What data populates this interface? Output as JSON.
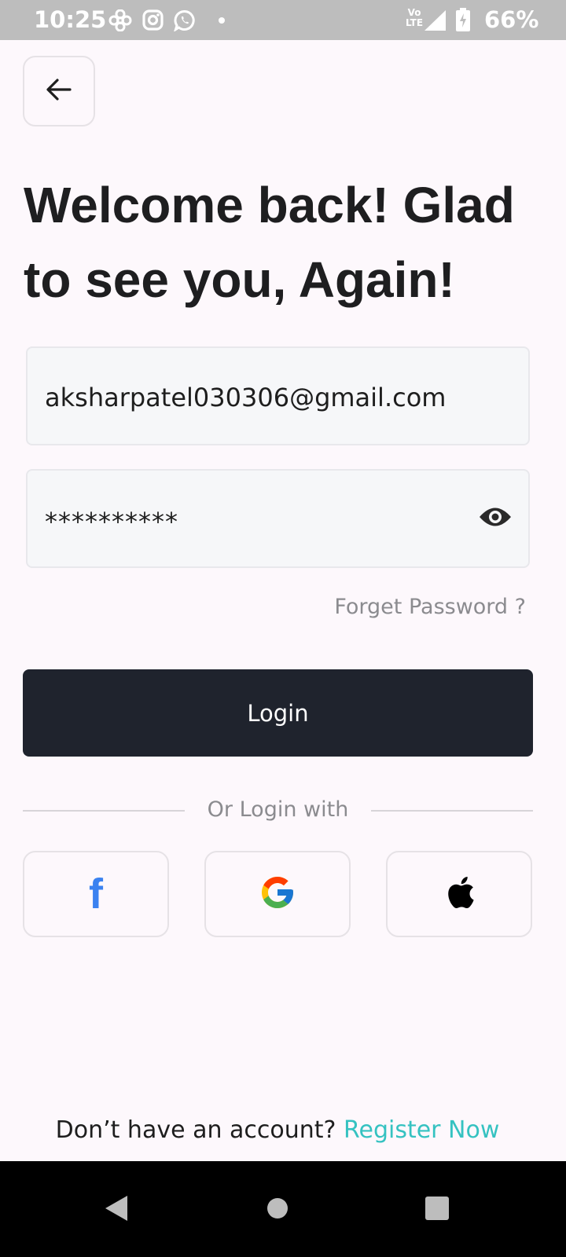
{
  "status_bar": {
    "time": "10:25",
    "volte_top": "Vo",
    "volte_bottom": "LTE",
    "battery_percent": "66%",
    "icons": [
      "fan-icon",
      "instagram-icon",
      "whatsapp-icon",
      "dot-icon",
      "volte-icon",
      "signal-icon",
      "battery-icon"
    ]
  },
  "back_button": {
    "icon": "arrow-left-icon"
  },
  "headline": "Welcome back! Glad to see you, Again!",
  "email_field": {
    "value": "aksharpatel030306@gmail.com"
  },
  "password_field": {
    "value": "**********",
    "icon": "eye-icon"
  },
  "forgot_password": "Forget Password ?",
  "login_button": "Login",
  "divider_text": "Or Login with",
  "social": [
    {
      "name": "facebook",
      "glyph": "f",
      "icon": "facebook-icon",
      "color": "#3b82f0"
    },
    {
      "name": "google",
      "icon": "google-icon"
    },
    {
      "name": "apple",
      "icon": "apple-icon"
    }
  ],
  "register": {
    "prompt": "Don’t have an account? ",
    "link": "Register Now"
  },
  "colors": {
    "background": "#fdf8fc",
    "primary_button": "#1f232d",
    "accent": "#35c2c1",
    "muted_text": "#8b8b8f",
    "field_bg": "#f6f7f9"
  },
  "nav_bar": {
    "buttons": [
      "back-triangle-icon",
      "home-circle-icon",
      "recents-square-icon"
    ]
  }
}
